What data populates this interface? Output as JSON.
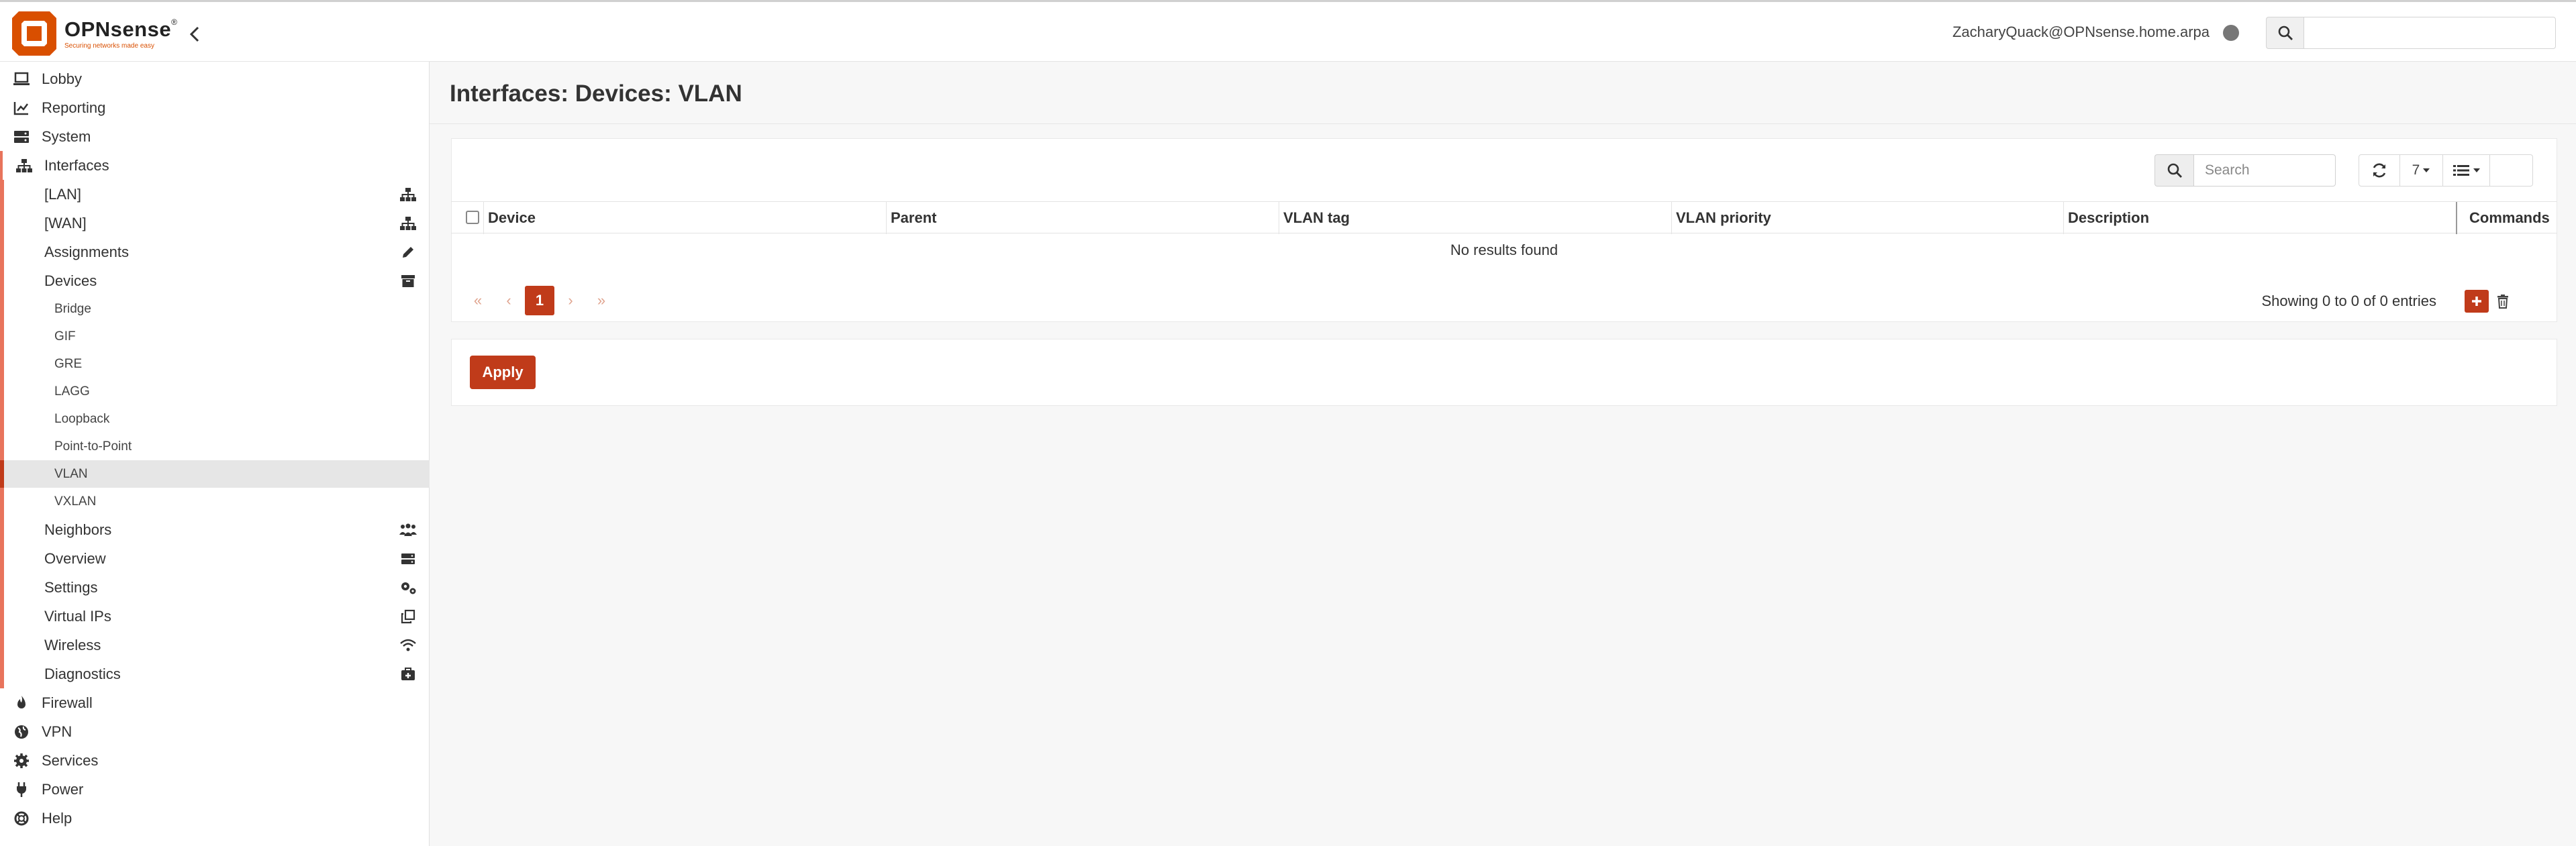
{
  "brand": {
    "name": "OPNsense",
    "trademark": "®",
    "tagline": "Securing networks made easy"
  },
  "header": {
    "user": "ZacharyQuack@OPNsense.home.arpa",
    "search_placeholder": ""
  },
  "sidebar": {
    "items": [
      {
        "label": "Lobby",
        "icon": "laptop-icon"
      },
      {
        "label": "Reporting",
        "icon": "chart-icon"
      },
      {
        "label": "System",
        "icon": "server-icon"
      },
      {
        "label": "Interfaces",
        "icon": "sitemap-icon"
      }
    ],
    "interfaces_children": [
      {
        "label": "[LAN]",
        "icon": "sitemap-icon"
      },
      {
        "label": "[WAN]",
        "icon": "sitemap-icon"
      },
      {
        "label": "Assignments",
        "icon": "pencil-icon"
      },
      {
        "label": "Devices",
        "icon": "archive-icon"
      }
    ],
    "devices_children": [
      "Bridge",
      "GIF",
      "GRE",
      "LAGG",
      "Loopback",
      "Point-to-Point",
      "VLAN",
      "VXLAN"
    ],
    "more_interfaces_children": [
      {
        "label": "Neighbors",
        "icon": "users-icon"
      },
      {
        "label": "Overview",
        "icon": "server-icon"
      },
      {
        "label": "Settings",
        "icon": "cogs-icon"
      },
      {
        "label": "Virtual IPs",
        "icon": "clone-icon"
      },
      {
        "label": "Wireless",
        "icon": "wifi-icon"
      },
      {
        "label": "Diagnostics",
        "icon": "medkit-icon"
      }
    ],
    "bottom_items": [
      {
        "label": "Firewall",
        "icon": "fire-icon"
      },
      {
        "label": "VPN",
        "icon": "globe-icon"
      },
      {
        "label": "Services",
        "icon": "cog-icon"
      },
      {
        "label": "Power",
        "icon": "plug-icon"
      },
      {
        "label": "Help",
        "icon": "lifering-icon"
      }
    ]
  },
  "page": {
    "title": "Interfaces: Devices: VLAN"
  },
  "grid": {
    "search_placeholder": "Search",
    "page_size": "7",
    "columns": [
      "Device",
      "Parent",
      "VLAN tag",
      "VLAN priority",
      "Description",
      "Commands"
    ],
    "empty_text": "No results found",
    "pager": [
      "«",
      "‹",
      "1",
      "›",
      "»"
    ],
    "entries_text": "Showing 0 to 0 of 0 entries"
  },
  "actions": {
    "apply_label": "Apply"
  },
  "colors": {
    "accent": "#c03b1a",
    "accent_light": "#e8745c"
  }
}
